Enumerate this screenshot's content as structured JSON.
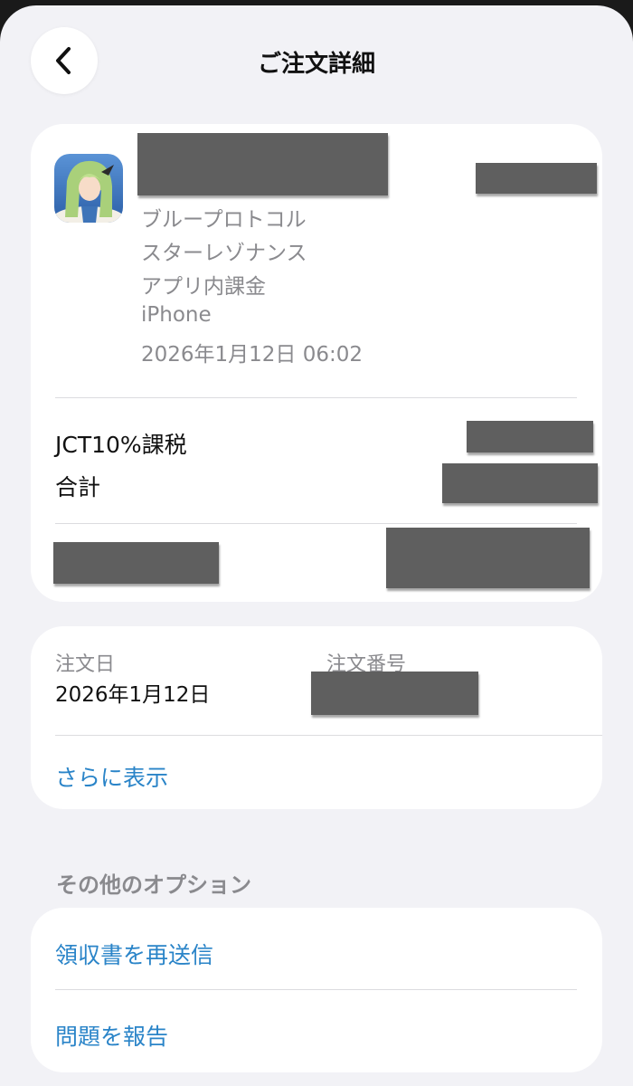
{
  "header": {
    "title": "ご注文詳細"
  },
  "purchase": {
    "app_lines": [
      "ブループロトコル",
      "スターレゾナンス",
      "アプリ内課金",
      "iPhone",
      "2026年1月12日 06:02"
    ],
    "tax_label": "JCT10%課税",
    "total_label": "合計"
  },
  "order": {
    "date_label": "注文日",
    "date_value": "2026年1月12日",
    "number_label": "注文番号",
    "more_link": "さらに表示"
  },
  "options": {
    "section_title": "その他のオプション",
    "resend_receipt": "領収書を再送信",
    "report_problem": "問題を報告"
  },
  "colors": {
    "background": "#f2f2f6",
    "card": "#ffffff",
    "link": "#2a84c8",
    "secondary_text": "#8a8a8e",
    "redaction": "#5f5f5f"
  },
  "icons": {
    "back": "chevron-left-icon",
    "app": "app-icon"
  }
}
